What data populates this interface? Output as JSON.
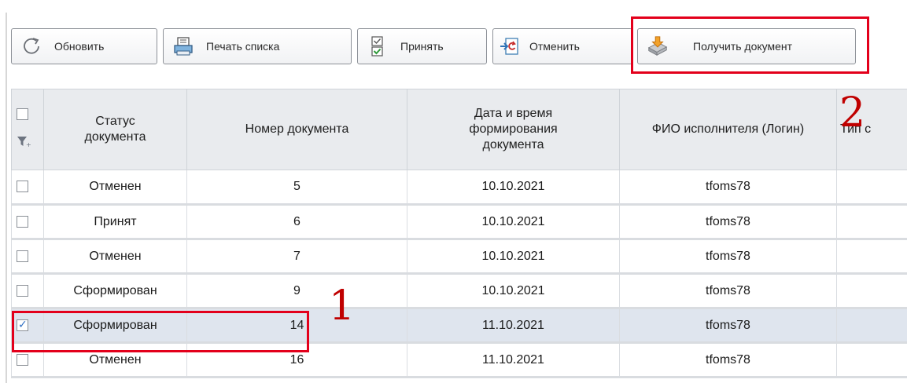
{
  "toolbar": {
    "buttons": [
      {
        "label": "Обновить",
        "icon": "refresh-icon"
      },
      {
        "label": "Печать списка",
        "icon": "printer-icon"
      },
      {
        "label": "Принять",
        "icon": "accept-icon"
      },
      {
        "label": "Отменить",
        "icon": "cancel-icon"
      },
      {
        "label": "Получить документ",
        "icon": "get-document-icon"
      }
    ]
  },
  "annotations": {
    "marker_1": "1",
    "marker_2": "2"
  },
  "table": {
    "columns": [
      {
        "label": ""
      },
      {
        "label": "Статус\nдокумента"
      },
      {
        "label": "Номер документа"
      },
      {
        "label": "Дата и время\nформирования\nдокумента"
      },
      {
        "label": "ФИО исполнителя (Логин)"
      },
      {
        "label": "Тип с"
      }
    ],
    "rows": [
      {
        "checked": false,
        "status": "Отменен",
        "number": "5",
        "date": "10.10.2021",
        "login": "tfoms78",
        "type": ""
      },
      {
        "checked": false,
        "status": "Принят",
        "number": "6",
        "date": "10.10.2021",
        "login": "tfoms78",
        "type": ""
      },
      {
        "checked": false,
        "status": "Отменен",
        "number": "7",
        "date": "10.10.2021",
        "login": "tfoms78",
        "type": ""
      },
      {
        "checked": false,
        "status": "Сформирован",
        "number": "9",
        "date": "10.10.2021",
        "login": "tfoms78",
        "type": ""
      },
      {
        "checked": true,
        "status": "Сформирован",
        "number": "14",
        "date": "11.10.2021",
        "login": "tfoms78",
        "type": ""
      },
      {
        "checked": false,
        "status": "Отменен",
        "number": "16",
        "date": "11.10.2021",
        "login": "tfoms78",
        "type": ""
      }
    ]
  },
  "colors": {
    "highlight": "#e3001b",
    "selected_row": "#dfe5ee",
    "header_bg": "#e9ebee",
    "marker_text": "#c00000"
  }
}
